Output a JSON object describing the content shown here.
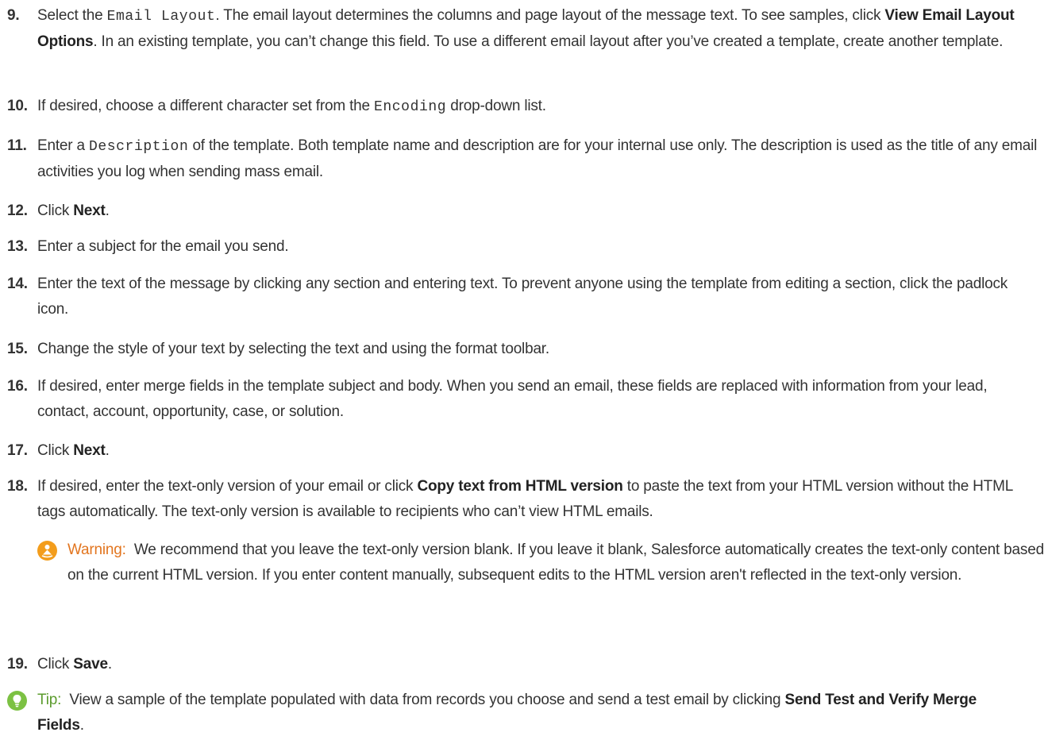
{
  "steps": [
    {
      "num": "9.",
      "parts": [
        {
          "t": "Select the "
        },
        {
          "t": "Email Layout",
          "mono": true
        },
        {
          "t": ". The email layout determines the columns and page layout of the message text. To see samples, click "
        },
        {
          "t": "View Email Layout Options",
          "b": true
        },
        {
          "t": ". In an existing template, you can’t change this field. To use a different email layout after you’ve created a template, create another template."
        }
      ]
    },
    {
      "num": "10.",
      "parts": [
        {
          "t": "If desired, choose a different character set from the "
        },
        {
          "t": "Encoding",
          "mono": true
        },
        {
          "t": " drop-down list."
        }
      ]
    },
    {
      "num": "11.",
      "parts": [
        {
          "t": "Enter a "
        },
        {
          "t": "Description",
          "mono": true
        },
        {
          "t": " of the template. Both template name and description are for your internal use only. The description is used as the title of any email activities you log when sending mass email."
        }
      ]
    },
    {
      "num": "12.",
      "parts": [
        {
          "t": "Click "
        },
        {
          "t": "Next",
          "b": true
        },
        {
          "t": "."
        }
      ]
    },
    {
      "num": "13.",
      "parts": [
        {
          "t": "Enter a subject for the email you send."
        }
      ]
    },
    {
      "num": "14.",
      "parts": [
        {
          "t": "Enter the text of the message by clicking any section and entering text. To prevent anyone using the template from editing a section, click the padlock icon."
        }
      ]
    },
    {
      "num": "15.",
      "parts": [
        {
          "t": "Change the style of your text by selecting the text and using the format toolbar."
        }
      ]
    },
    {
      "num": "16.",
      "parts": [
        {
          "t": "If desired, enter merge fields in the template subject and body. When you send an email, these fields are replaced with information from your lead, contact, account, opportunity, case, or solution."
        }
      ]
    },
    {
      "num": "17.",
      "parts": [
        {
          "t": "Click "
        },
        {
          "t": "Next",
          "b": true
        },
        {
          "t": "."
        }
      ]
    },
    {
      "num": "18.",
      "parts": [
        {
          "t": "If desired, enter the text-only version of your email or click "
        },
        {
          "t": "Copy text from HTML version",
          "b": true
        },
        {
          "t": " to paste the text from your HTML version without the HTML tags automatically. The text-only version is available to recipients who can’t view HTML emails."
        }
      ]
    },
    {
      "num": "19.",
      "parts": [
        {
          "t": "Click "
        },
        {
          "t": "Save",
          "b": true
        },
        {
          "t": "."
        }
      ]
    }
  ],
  "warning": {
    "label": "Warning:",
    "text": "We recommend that you leave the text-only version blank. If you leave it blank, Salesforce automatically creates the text-only content based on the current HTML version. If you enter content manually, subsequent edits to the HTML version aren't reflected in the text-only version.",
    "icon": "warning-person-icon",
    "color": "#e2751f"
  },
  "tip": {
    "label": "Tip:",
    "parts": [
      {
        "t": "View a sample of the template populated with data from records you choose and send a test email by clicking "
      },
      {
        "t": "Send Test and Verify Merge Fields",
        "b": true
      },
      {
        "t": "."
      }
    ],
    "icon": "lightbulb-icon",
    "color": "#5c9c2e"
  }
}
